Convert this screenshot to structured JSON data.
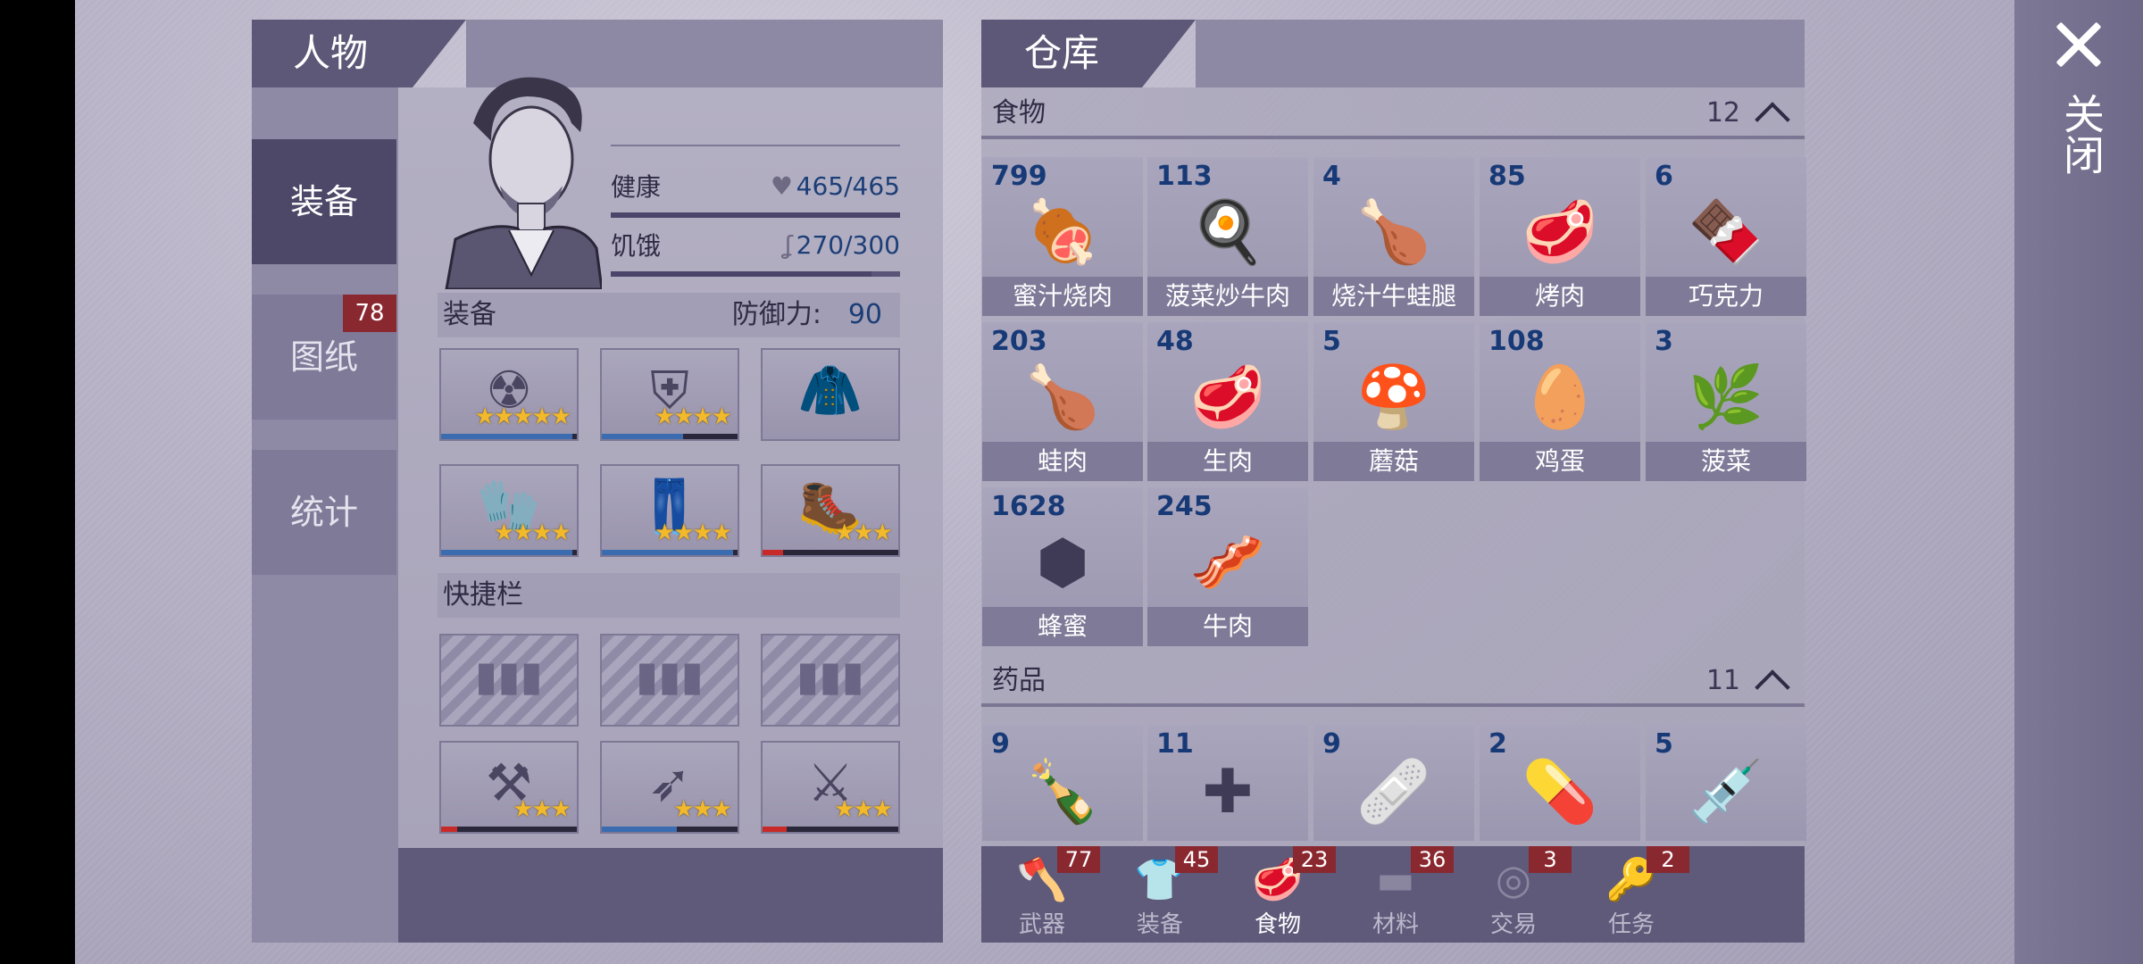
{
  "close_label": "关闭",
  "character": {
    "title": "人物",
    "nav": [
      {
        "label": "装备",
        "badge": ""
      },
      {
        "label": "图纸",
        "badge": "78"
      },
      {
        "label": "统计",
        "badge": ""
      }
    ],
    "health": {
      "label": "健康",
      "value": "465/465",
      "fraction": 1.0
    },
    "hunger": {
      "label": "饥饿",
      "value": "270/300",
      "fraction": 0.9
    },
    "equip_section": "装备",
    "defense_label": "防御力:",
    "defense_value": "90",
    "quickbar_section": "快捷栏",
    "equipment": [
      {
        "icon": "gas-mask-icon",
        "stars": "★★★★★",
        "durability": 0.97,
        "bar_color": "#3c6cb0"
      },
      {
        "icon": "armor-vest-icon",
        "stars": "★★★★",
        "durability": 0.6,
        "bar_color": "#3c6cb0"
      },
      {
        "icon": "jacket-icon",
        "stars": "",
        "durability": null,
        "bar_color": ""
      },
      {
        "icon": "gloves-icon",
        "stars": "★★★★",
        "durability": 0.97,
        "bar_color": "#3c6cb0"
      },
      {
        "icon": "pants-icon",
        "stars": "★★★★",
        "durability": 0.97,
        "bar_color": "#3c6cb0"
      },
      {
        "icon": "boots-icon",
        "stars": "★★★",
        "durability": 0.15,
        "bar_color": "#c82a2a"
      }
    ],
    "weapons": [
      {
        "icon": "spiked-hammer-icon",
        "stars": "★★★",
        "durability": 0.12,
        "bar_color": "#c82a2a"
      },
      {
        "icon": "spear-icon",
        "stars": "★★★",
        "durability": 0.55,
        "bar_color": "#3c6cb0"
      },
      {
        "icon": "club-icon",
        "stars": "★★★",
        "durability": 0.18,
        "bar_color": "#c82a2a"
      }
    ]
  },
  "warehouse": {
    "title": "仓库",
    "food": {
      "label": "食物",
      "count": "12",
      "items": [
        {
          "qty": "799",
          "name": "蜜汁烧肉",
          "icon": "roast-meat-icon",
          "glyph": "🍖"
        },
        {
          "qty": "113",
          "name": "菠菜炒牛肉",
          "icon": "pan-dish-icon",
          "glyph": "🍳"
        },
        {
          "qty": "4",
          "name": "烧汁牛蛙腿",
          "icon": "frog-legs-icon",
          "glyph": "🍗"
        },
        {
          "qty": "85",
          "name": "烤肉",
          "icon": "steak-icon",
          "glyph": "🥩"
        },
        {
          "qty": "6",
          "name": "巧克力",
          "icon": "chocolate-icon",
          "glyph": "🍫"
        },
        {
          "qty": "203",
          "name": "蛙肉",
          "icon": "frog-meat-icon",
          "glyph": "🍗"
        },
        {
          "qty": "48",
          "name": "生肉",
          "icon": "raw-meat-icon",
          "glyph": "🥩"
        },
        {
          "qty": "5",
          "name": "蘑菇",
          "icon": "mushroom-icon",
          "glyph": "🍄"
        },
        {
          "qty": "108",
          "name": "鸡蛋",
          "icon": "eggs-icon",
          "glyph": "🥚"
        },
        {
          "qty": "3",
          "name": "菠菜",
          "icon": "spinach-icon",
          "glyph": "🌿"
        },
        {
          "qty": "1628",
          "name": "蜂蜜",
          "icon": "honeycomb-icon",
          "glyph": "⬢"
        },
        {
          "qty": "245",
          "name": "牛肉",
          "icon": "beef-icon",
          "glyph": "🥓"
        }
      ]
    },
    "medicine": {
      "label": "药品",
      "count": "11",
      "items": [
        {
          "qty": "9",
          "icon": "bottle-icon",
          "glyph": "🍾"
        },
        {
          "qty": "11",
          "icon": "first-aid-kit-icon",
          "glyph": "✚"
        },
        {
          "qty": "9",
          "icon": "bandage-icon",
          "glyph": "🩹"
        },
        {
          "qty": "2",
          "icon": "pill-jar-icon",
          "glyph": "💊"
        },
        {
          "qty": "5",
          "icon": "syringe-icon",
          "glyph": "💉"
        }
      ]
    },
    "tabs": [
      {
        "label": "武器",
        "badge": "77",
        "icon": "axe-icon",
        "glyph": "🪓"
      },
      {
        "label": "装备",
        "badge": "45",
        "icon": "shirt-icon",
        "glyph": "👕"
      },
      {
        "label": "食物",
        "badge": "23",
        "icon": "steak-tab-icon",
        "glyph": "🥩"
      },
      {
        "label": "材料",
        "badge": "36",
        "icon": "plank-icon",
        "glyph": "▬"
      },
      {
        "label": "交易",
        "badge": "3",
        "icon": "coin-icon",
        "glyph": "◎"
      },
      {
        "label": "任务",
        "badge": "2",
        "icon": "key-icon",
        "glyph": "🔑"
      }
    ],
    "active_tab": 2
  }
}
